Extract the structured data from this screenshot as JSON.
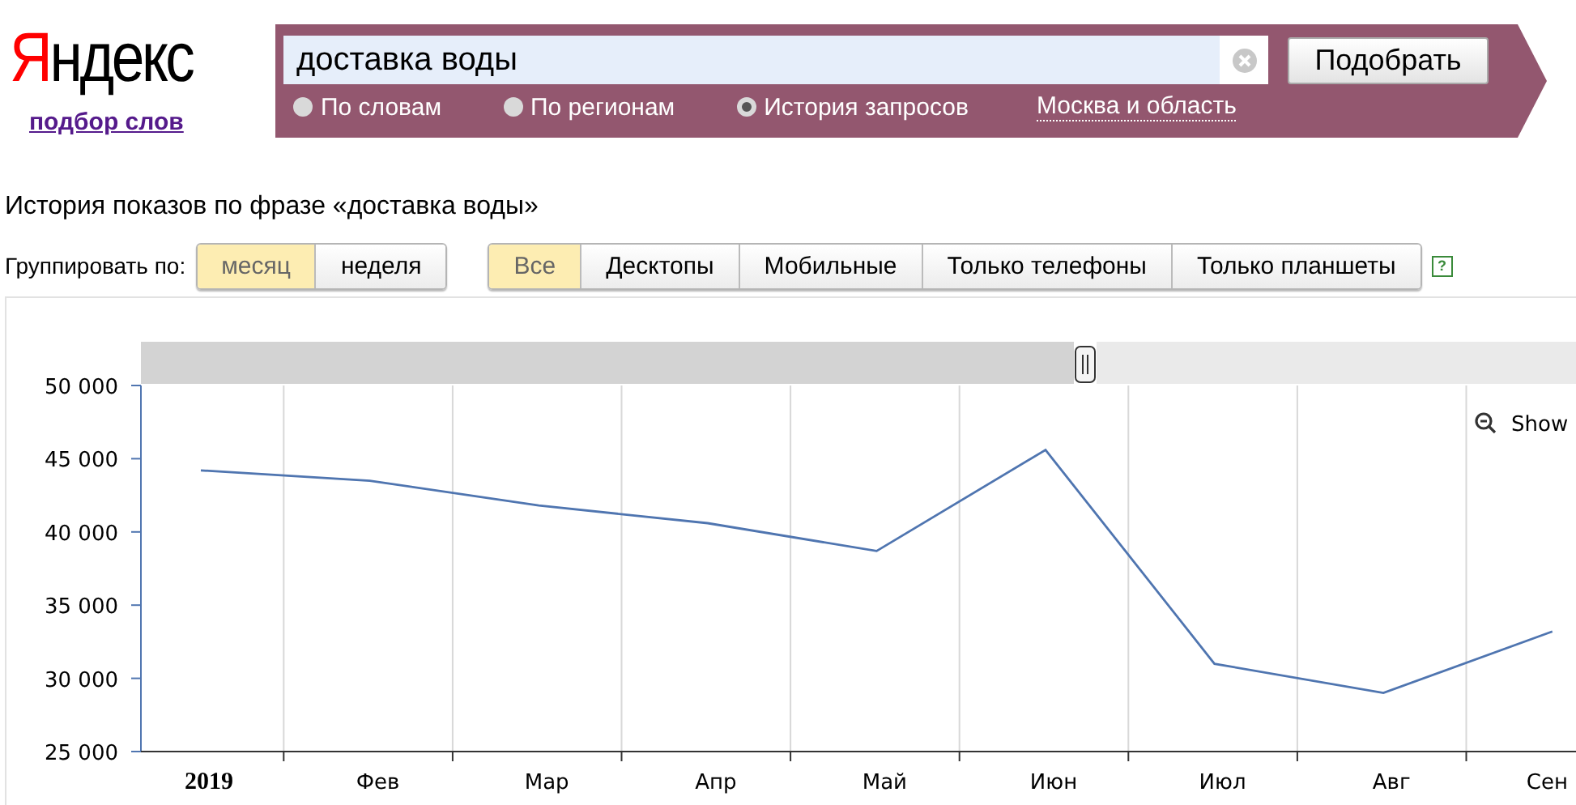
{
  "logo": "Яндекс",
  "logo_link": "подбор слов",
  "search": {
    "value": "доставка воды",
    "button": "Подобрать"
  },
  "modes": [
    {
      "label": "По словам",
      "selected": false
    },
    {
      "label": "По регионам",
      "selected": false
    },
    {
      "label": "История запросов",
      "selected": true
    }
  ],
  "region": "Москва и область",
  "heading": "История показов по фразе «доставка воды»",
  "group_label": "Группировать по:",
  "group_tabs": [
    {
      "label": "месяц",
      "selected": true
    },
    {
      "label": "неделя",
      "selected": false
    }
  ],
  "device_tabs": [
    {
      "label": "Все",
      "selected": true
    },
    {
      "label": "Десктопы",
      "selected": false
    },
    {
      "label": "Мобильные",
      "selected": false
    },
    {
      "label": "Только телефоны",
      "selected": false
    },
    {
      "label": "Только планшеты",
      "selected": false
    }
  ],
  "help": "?",
  "show_label": "Show",
  "chart_data": {
    "type": "line",
    "categories": [
      "2019",
      "Фев",
      "Мар",
      "Апр",
      "Май",
      "Июн",
      "Июл",
      "Авг",
      "Сен"
    ],
    "series": [
      {
        "color": "#4f75b0",
        "values": [
          44200,
          43500,
          41800,
          40600,
          38700,
          45600,
          31000,
          29000,
          33200
        ]
      }
    ],
    "ylim": [
      25000,
      50000
    ],
    "yticks": [
      {
        "value": 25000,
        "label": "25 000"
      },
      {
        "value": 30000,
        "label": "30 000"
      },
      {
        "value": 35000,
        "label": "35 000"
      },
      {
        "value": 40000,
        "label": "40 000"
      },
      {
        "value": 45000,
        "label": "45 000"
      },
      {
        "value": 50000,
        "label": "50 000"
      }
    ]
  }
}
